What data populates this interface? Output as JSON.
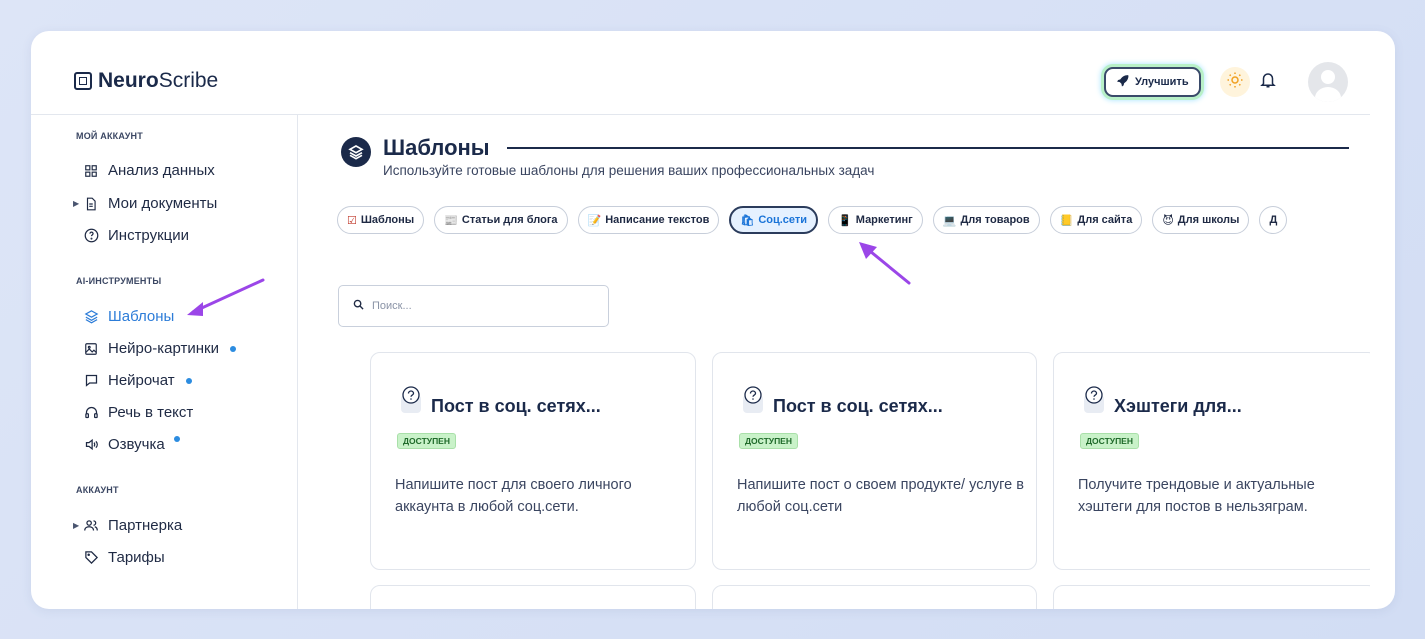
{
  "app": {
    "brand_bold": "Neuro",
    "brand_light": "Scribe",
    "upgrade_label": "Улучшить"
  },
  "sidebar": {
    "sections": [
      {
        "title": "МОЙ АККАУНТ"
      },
      {
        "title": "AI-ИНСТРУМЕНТЫ"
      },
      {
        "title": "АККАУНТ"
      }
    ],
    "items": [
      {
        "label": "Анализ данных",
        "icon": "grid-icon"
      },
      {
        "label": "Мои документы",
        "icon": "document-icon"
      },
      {
        "label": "Инструкции",
        "icon": "help-circle-icon"
      },
      {
        "label": "Шаблоны",
        "icon": "layers-icon",
        "active": true
      },
      {
        "label": "Нейро-картинки",
        "icon": "image-icon"
      },
      {
        "label": "Нейрочат",
        "icon": "chat-icon"
      },
      {
        "label": "Речь в текст",
        "icon": "headphones-icon"
      },
      {
        "label": "Озвучка",
        "icon": "speaker-icon"
      },
      {
        "label": "Партнерка",
        "icon": "users-icon"
      },
      {
        "label": "Тарифы",
        "icon": "tag-icon"
      }
    ]
  },
  "main": {
    "title": "Шаблоны",
    "subtitle": "Используйте готовые шаблоны для решения ваших профессиональных задач",
    "chips": [
      {
        "emoji": "☑",
        "label": "Шаблоны"
      },
      {
        "emoji": "📰",
        "label": "Статьи для блога"
      },
      {
        "emoji": "📝",
        "label": "Написание текстов"
      },
      {
        "emoji": "🛍",
        "label": "Соц.сети",
        "active": true
      },
      {
        "emoji": "📱",
        "label": "Маркетинг"
      },
      {
        "emoji": "💻",
        "label": "Для товаров"
      },
      {
        "emoji": "📒",
        "label": "Для сайта"
      },
      {
        "emoji": "😈",
        "label": "Для школы"
      },
      {
        "emoji": "",
        "label": "Д"
      }
    ],
    "search_placeholder": "Поиск...",
    "cards": [
      {
        "title": "Пост в соц. сетях...",
        "badge": "доступен",
        "desc": "Напишите пост для своего личного аккаунта в любой соц.сети."
      },
      {
        "title": "Пост в соц. сетях...",
        "badge": "доступен",
        "desc": "Напишите пост о своем продукте/ услуге в любой соц.сети"
      },
      {
        "title": "Хэштеги для...",
        "badge": "доступен",
        "desc": "Получите трендовые и актуальные хэштеги для постов в нельзяграм."
      }
    ]
  },
  "colors": {
    "accent": "#2c7cd8",
    "dark": "#1b2a4a",
    "badge_bg": "#c9f2c9",
    "arrow": "#9b46e8"
  }
}
